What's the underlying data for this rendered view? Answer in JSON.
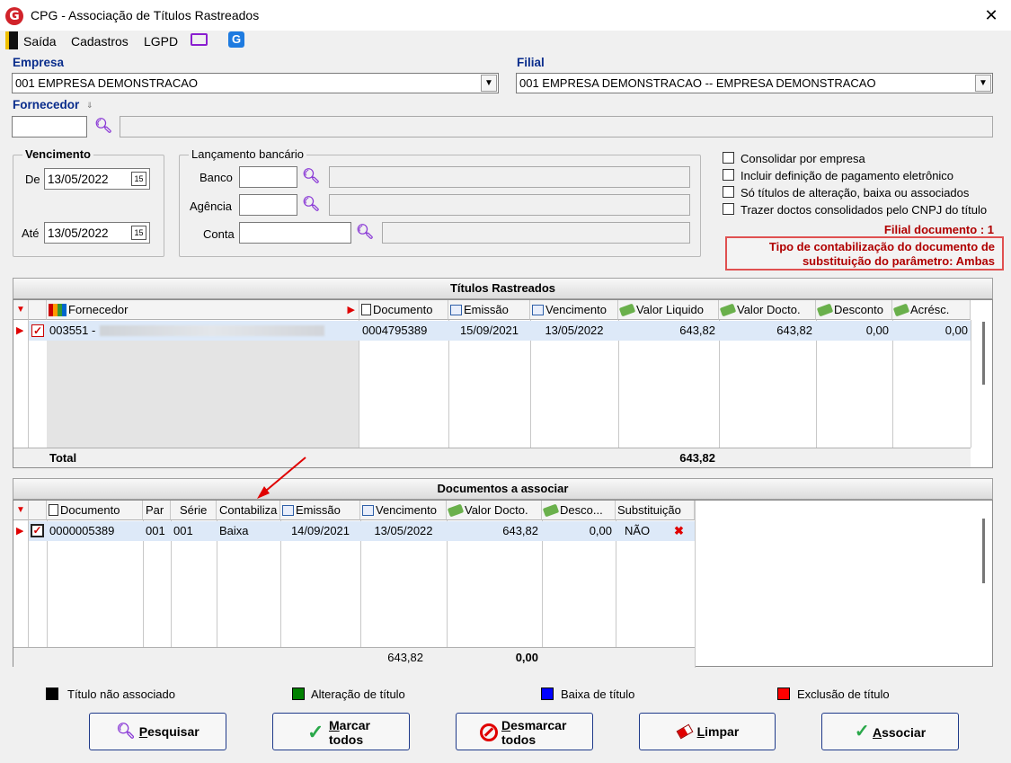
{
  "window": {
    "title": "CPG - Associação de Títulos Rastreados",
    "logo_letter": "G"
  },
  "menu": {
    "saida": "Saída",
    "cadastros": "Cadastros",
    "lgpd": "LGPD"
  },
  "empresa": {
    "label": "Empresa",
    "value": "001 EMPRESA DEMONSTRACAO"
  },
  "filial": {
    "label": "Filial",
    "value": "001 EMPRESA DEMONSTRACAO -- EMPRESA DEMONSTRACAO"
  },
  "fornecedor": {
    "label": "Fornecedor",
    "code": "",
    "name": ""
  },
  "vencimento": {
    "label": "Vencimento",
    "de_label": "De",
    "de_value": "13/05/2022",
    "ate_label": "Até",
    "ate_value": "13/05/2022",
    "cal_glyph": "15"
  },
  "lancamento": {
    "label": "Lançamento bancário",
    "banco": "Banco",
    "agencia": "Agência",
    "conta": "Conta"
  },
  "options": [
    {
      "label": "Consolidar por empresa",
      "checked": false
    },
    {
      "label": "Incluir definição de pagamento eletrônico",
      "checked": false
    },
    {
      "label": "Só títulos de alteração, baixa ou associados",
      "checked": false
    },
    {
      "label": "Trazer doctos consolidados pelo CNPJ do título",
      "checked": false
    }
  ],
  "filial_documento": "Filial documento : 1",
  "tipo_contabilizacao": {
    "line1": "Tipo de contabilização do documento de",
    "line2": "substituição do parâmetro: Ambas"
  },
  "titulos": {
    "title": "Títulos Rastreados",
    "headers": {
      "fornecedor": "Fornecedor",
      "documento": "Documento",
      "emissao": "Emissão",
      "vencimento": "Vencimento",
      "valor_liquido": "Valor Liquido",
      "valor_docto": "Valor Docto.",
      "desconto": "Desconto",
      "acresc": "Acrésc."
    },
    "rows": [
      {
        "fornecedor": "003551 -",
        "documento": "0004795389",
        "emissao": "15/09/2021",
        "vencimento": "13/05/2022",
        "valor_liquido": "643,82",
        "valor_docto": "643,82",
        "desconto": "0,00",
        "acresc": "0,00",
        "checked": true
      }
    ],
    "total_label": "Total",
    "total_value": "643,82"
  },
  "documentos": {
    "title": "Documentos a associar",
    "headers": {
      "documento": "Documento",
      "par": "Par",
      "serie": "Série",
      "contabiliza": "Contabiliza",
      "emissao": "Emissão",
      "vencimento": "Vencimento",
      "valor_docto": "Valor Docto.",
      "desconto": "Desco...",
      "substituicao": "Substituição"
    },
    "rows": [
      {
        "documento": "0000005389",
        "par": "001",
        "serie": "001",
        "contabiliza": "Baixa",
        "emissao": "14/09/2021",
        "vencimento": "13/05/2022",
        "valor_docto": "643,82",
        "desconto": "0,00",
        "substituicao": "NÃO",
        "checked": true
      }
    ],
    "footer_valor": "643,82",
    "footer_desconto": "0,00"
  },
  "legend": [
    {
      "label": "Título não associado",
      "color": "#000000"
    },
    {
      "label": "Alteração de título",
      "color": "#008000"
    },
    {
      "label": "Baixa de título",
      "color": "#0000ff"
    },
    {
      "label": "Exclusão de título",
      "color": "#ff0000"
    }
  ],
  "buttons": {
    "pesquisar": {
      "u": "P",
      "rest": "esquisar"
    },
    "marcar": {
      "u": "M",
      "rest": "arcar",
      "line2": "todos"
    },
    "desmarcar": {
      "u": "D",
      "rest": "esmarcar",
      "line2": "todos"
    },
    "limpar": {
      "u": "L",
      "rest": "impar"
    },
    "associar": {
      "u": "A",
      "rest": "ssociar"
    }
  },
  "colors": {
    "accent": "#0a2d8c",
    "alert": "#b00000",
    "search": "#8a39d6"
  },
  "icons": [
    "app-logo-icon",
    "close-icon",
    "exit-icon",
    "monitor-icon",
    "g-app-icon",
    "search-icon",
    "calendar-icon",
    "document-icon",
    "money-icon",
    "checkbox-icon",
    "delete-x-icon",
    "red-arrow-annotation"
  ]
}
